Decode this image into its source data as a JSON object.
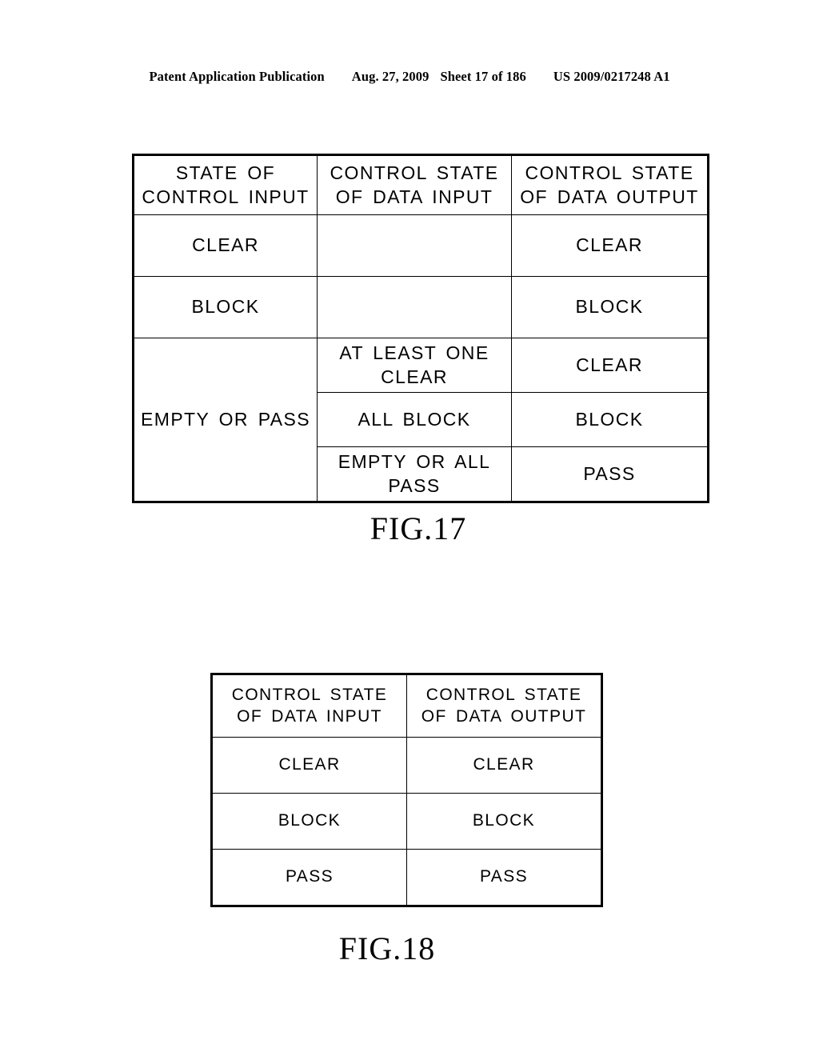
{
  "header": {
    "publication": "Patent Application Publication",
    "date": "Aug. 27, 2009",
    "sheet": "Sheet 17 of 186",
    "patent_number": "US 2009/0217248 A1"
  },
  "figures": [
    {
      "id": "fig17",
      "caption": "FIG.17",
      "columns": [
        "STATE OF CONTROL INPUT",
        "CONTROL STATE OF DATA INPUT",
        "CONTROL STATE OF DATA OUTPUT"
      ],
      "header_lines": {
        "col1_line1": "STATE OF",
        "col1_line2": "CONTROL INPUT",
        "col2_line1": "CONTROL STATE",
        "col2_line2": "OF DATA INPUT",
        "col3_line1": "CONTROL STATE",
        "col3_line2": "OF DATA OUTPUT"
      },
      "rows": [
        {
          "control_input": "CLEAR",
          "data_input": "",
          "data_output": "CLEAR"
        },
        {
          "control_input": "BLOCK",
          "data_input": "",
          "data_output": "BLOCK"
        },
        {
          "control_input": "EMPTY OR PASS",
          "data_input_line1": "AT LEAST ONE",
          "data_input_line2": "CLEAR",
          "data_output": "CLEAR"
        },
        {
          "control_input": "",
          "data_input_line1": "ALL BLOCK",
          "data_input_line2": "",
          "data_output": "BLOCK"
        },
        {
          "control_input": "",
          "data_input_line1": "EMPTY OR ALL",
          "data_input_line2": "PASS",
          "data_output": "PASS"
        }
      ]
    },
    {
      "id": "fig18",
      "caption": "FIG.18",
      "columns": [
        "CONTROL STATE OF DATA INPUT",
        "CONTROL STATE OF DATA OUTPUT"
      ],
      "header_lines": {
        "col1_line1": "CONTROL STATE",
        "col1_line2": "OF DATA INPUT",
        "col2_line1": "CONTROL STATE",
        "col2_line2": "OF DATA OUTPUT"
      },
      "rows": [
        {
          "data_input": "CLEAR",
          "data_output": "CLEAR"
        },
        {
          "data_input": "BLOCK",
          "data_output": "BLOCK"
        },
        {
          "data_input": "PASS",
          "data_output": "PASS"
        }
      ]
    }
  ]
}
